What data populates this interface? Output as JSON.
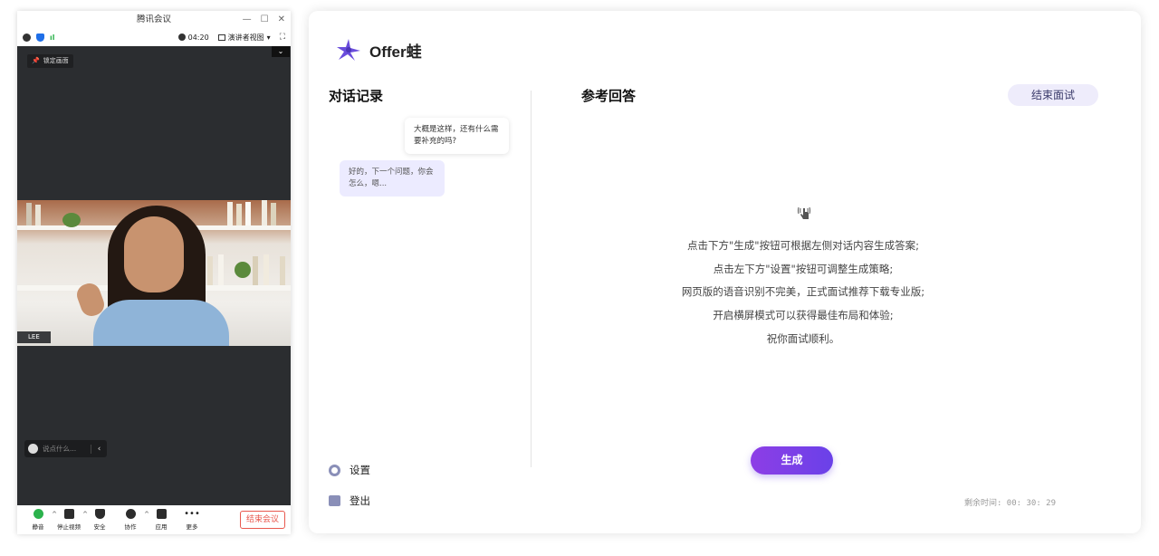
{
  "meeting": {
    "window_title": "腾讯会议",
    "timer": "04:20",
    "view_label": "演讲者视图",
    "lock_label": "锁定画面",
    "name_tag": "LEE",
    "speak_placeholder": "说点什么...",
    "toolbar": [
      {
        "label": "静音",
        "icon": "mic-icon"
      },
      {
        "label": "停止视频",
        "icon": "video-icon"
      },
      {
        "label": "安全",
        "icon": "shield-icon"
      },
      {
        "label": "协作",
        "icon": "collab-icon"
      },
      {
        "label": "应用",
        "icon": "apps-icon"
      },
      {
        "label": "更多",
        "icon": "more-icon"
      }
    ],
    "end_meeting": "结束会议",
    "colors": {
      "end": "#e8584e",
      "video_bg": "#2b2d30"
    }
  },
  "app": {
    "brand": "Offer蛙",
    "conversation_title": "对话记录",
    "answer_title": "参考回答",
    "end_interview": "结束面试",
    "messages": [
      {
        "side": "right",
        "text": "大概是这样，还有什么需要补充的吗?"
      },
      {
        "side": "left",
        "text": "好的，下一个问题，你会怎么，嗯..."
      }
    ],
    "hints": [
      "点击下方\"生成\"按钮可根据左侧对话内容生成答案;",
      "点击左下方\"设置\"按钮可调整生成策略;",
      "网页版的语音识别不完美，正式面试推荐下载专业版;",
      "开启横屏模式可以获得最佳布局和体验;",
      "祝你面试顺利。"
    ],
    "settings_label": "设置",
    "logout_label": "登出",
    "generate_label": "生成",
    "remaining_label": "剩余时间: 00: 30: 29",
    "colors": {
      "accent": "#7b3fe4",
      "bubble_left": "#ecebff",
      "end_btn_bg": "#eeecfb"
    }
  }
}
